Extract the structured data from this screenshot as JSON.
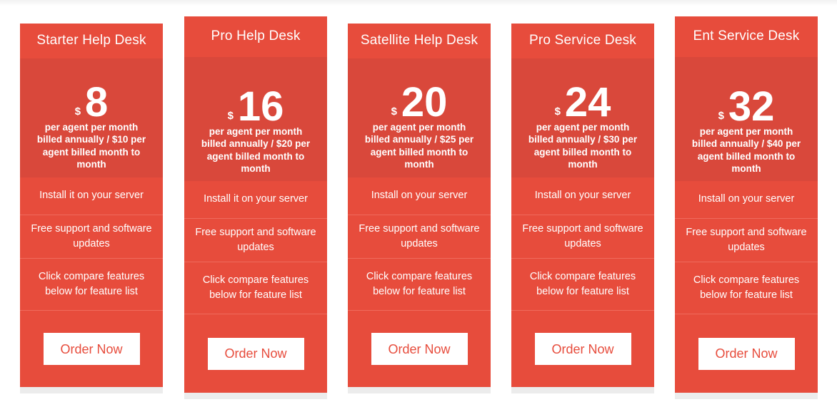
{
  "page": {
    "background_color": "#ffffff",
    "accent_color": "#e74c3c",
    "price_block_color": "#d9483b",
    "divider_color": "#ef6b5d",
    "shadow_color": "#ececec"
  },
  "plans": [
    {
      "name": "Starter Help Desk",
      "currency": "$",
      "price": "8",
      "price_note": "per agent per month billed annually / $10 per agent billed month to month",
      "features": [
        "Install it on your server",
        "Free support and software updates",
        "Click compare features below for feature list"
      ],
      "cta_label": "Order Now"
    },
    {
      "name": "Pro Help Desk",
      "currency": "$",
      "price": "16",
      "price_note": "per agent per month billed annually / $20 per agent billed month to month",
      "features": [
        "Install it on your server",
        "Free support and software updates",
        "Click compare features below for feature list"
      ],
      "cta_label": "Order Now"
    },
    {
      "name": "Satellite Help Desk",
      "currency": "$",
      "price": "20",
      "price_note": "per agent per month billed annually / $25 per agent billed month to month",
      "features": [
        "Install on your server",
        "Free support and software updates",
        "Click compare features below for feature list"
      ],
      "cta_label": "Order Now"
    },
    {
      "name": "Pro Service Desk",
      "currency": "$",
      "price": "24",
      "price_note": "per agent per month billed annually / $30 per agent billed month to month",
      "features": [
        "Install on your server",
        "Free support and software updates",
        "Click compare features below for feature list"
      ],
      "cta_label": "Order Now"
    },
    {
      "name": "Ent Service Desk",
      "currency": "$",
      "price": "32",
      "price_note": "per agent per month billed annually / $40 per agent billed month to month",
      "features": [
        "Install on your server",
        "Free support and software updates",
        "Click compare features below for feature list"
      ],
      "cta_label": "Order Now"
    }
  ]
}
